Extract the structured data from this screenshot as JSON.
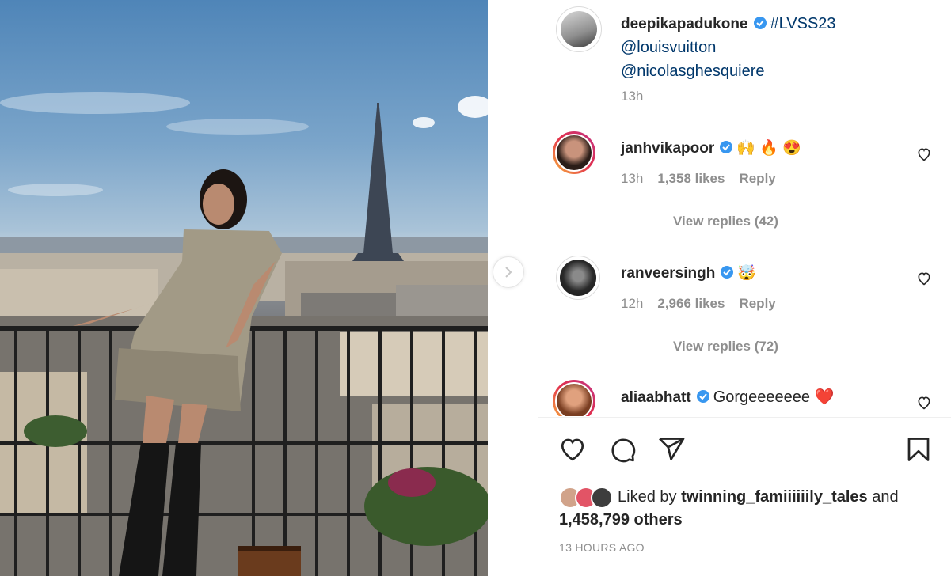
{
  "post": {
    "author": "deepikapadukone",
    "caption_tag": "#LVSS23",
    "mentions": [
      "@louisvuitton",
      "@nicolasghesquiere"
    ],
    "time": "13h"
  },
  "comments": [
    {
      "username": "janhvikapoor",
      "text": "🙌 🔥 😍",
      "time": "13h",
      "likes": "1,358 likes",
      "reply_label": "Reply",
      "view_replies": "View replies (42)"
    },
    {
      "username": "ranveersingh",
      "text": "🤯",
      "time": "12h",
      "likes": "2,966 likes",
      "reply_label": "Reply",
      "view_replies": "View replies (72)"
    },
    {
      "username": "aliaabhatt",
      "text": "Gorgeeeeeee ❤️"
    }
  ],
  "likes": {
    "prefix": "Liked by",
    "user": "twinning_famiiiiiily_tales",
    "and": "and",
    "others": "1,458,799 others"
  },
  "timestamp": "13 HOURS AGO",
  "icons": {
    "like": "heart-icon",
    "comment": "comment-icon",
    "share": "paper-plane-icon",
    "save": "bookmark-icon",
    "next": "chevron-right-icon",
    "verified": "verified-badge-icon"
  },
  "colors": {
    "verified": "#3897f0",
    "link": "#00376b",
    "secondary_text": "#8e8e8e"
  }
}
